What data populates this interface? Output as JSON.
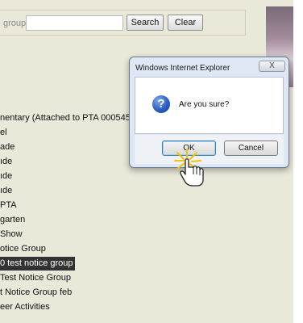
{
  "search": {
    "label": "group:",
    "input_value": "",
    "search_button": "Search",
    "clear_button": "Clear"
  },
  "groups": {
    "items": [
      {
        "label": "nentary (Attached to PTA 0005458",
        "selected": false
      },
      {
        "label": "el",
        "selected": false
      },
      {
        "label": "ade",
        "selected": false
      },
      {
        "label": "ıde",
        "selected": false
      },
      {
        "label": "ıde",
        "selected": false
      },
      {
        "label": "ıde",
        "selected": false
      },
      {
        "label": "PTA",
        "selected": false
      },
      {
        "label": "garten",
        "selected": false
      },
      {
        "label": "Show",
        "selected": false
      },
      {
        "label": "otice Group",
        "selected": false
      },
      {
        "label": "0 test notice group",
        "selected": true
      },
      {
        "label": "Test Notice Group",
        "selected": false
      },
      {
        "label": "t Notice Group feb",
        "selected": false
      },
      {
        "label": "eer Activities",
        "selected": false
      }
    ]
  },
  "dialog": {
    "title": "Windows Internet Explorer",
    "close_glyph": "X",
    "icon": "question-icon",
    "icon_glyph": "?",
    "message": "Are you sure?",
    "ok_label": "OK",
    "cancel_label": "Cancel"
  },
  "cursor": {
    "icon": "hand-pointer-icon"
  },
  "colors": {
    "page_background": "#eae8d8",
    "selected_row_background": "#333333",
    "dialog_frame": "#dde8f4",
    "question_icon": "#2c5fc7"
  }
}
